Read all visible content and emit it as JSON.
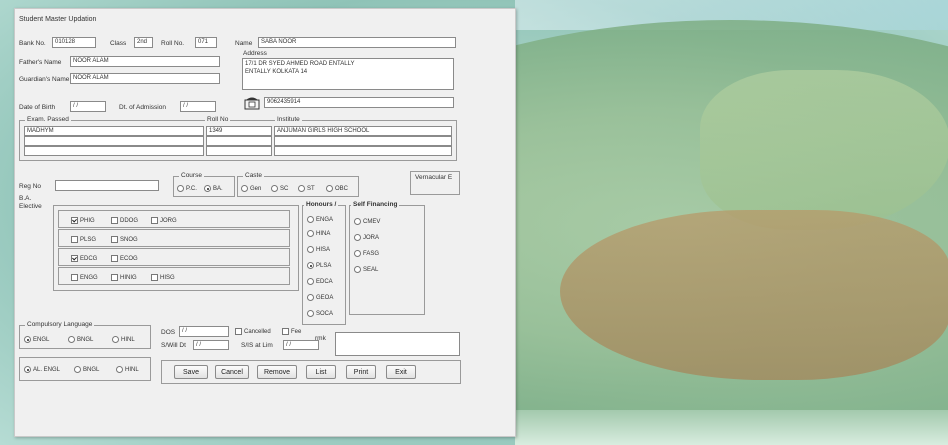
{
  "window": {
    "title": "Student Master Updation"
  },
  "fields": {
    "bank_no_label": "Bank No.",
    "bank_no_value": "010128",
    "class_label": "Class",
    "class_value": "2nd",
    "roll_no_label": "Roll No.",
    "roll_no_value": "071",
    "name_label": "Name",
    "name_value": "SABA NOOR",
    "father_label": "Father's Name",
    "father_value": "NOOR ALAM",
    "guardian_label": "Guardian's Name",
    "guardian_value": "NOOR ALAM",
    "address_label": "Address",
    "address_line1": "17/1 DR SYED AHMED ROAD ENTALLY",
    "address_line2": "ENTALLY KOLKATA 14",
    "dob_label": "Date of Birth",
    "dob_value": "/ /",
    "admission_label": "Dt. of Admission",
    "admission_value": "/ /",
    "phone_value": "9062435914",
    "reg_no_label": "Reg No",
    "ba_label": "B.A.",
    "elective_label": "Elective"
  },
  "exam_group": {
    "label": "Exam. Passed",
    "roll_label": "Roll No",
    "institute_label": "Institute",
    "exam_value": "MADHYM",
    "roll_value": "1349",
    "institute_value": "ANJUMAN GIRLS HIGH SCHOOL"
  },
  "course": {
    "label": "Course",
    "options": [
      "P.C.",
      "BA."
    ],
    "selected": 1
  },
  "caste": {
    "label": "Caste",
    "options": [
      "Gen",
      "SC",
      "ST",
      "OBC"
    ]
  },
  "vernacular_label": "Vernacular E",
  "elective_rows": [
    {
      "items": [
        {
          "label": "PHIG",
          "checked": true
        },
        {
          "label": "DDOG",
          "checked": false
        },
        {
          "label": "JORG",
          "checked": false
        }
      ]
    },
    {
      "items": [
        {
          "label": "PLSG",
          "checked": false
        },
        {
          "label": "SNOG",
          "checked": false
        }
      ]
    },
    {
      "items": [
        {
          "label": "EDCG",
          "checked": true
        },
        {
          "label": "ECOG",
          "checked": false
        }
      ]
    },
    {
      "items": [
        {
          "label": "ENGG",
          "checked": false
        },
        {
          "label": "HINIG",
          "checked": false
        },
        {
          "label": "HISG",
          "checked": false
        }
      ]
    }
  ],
  "honours": {
    "label": "Honours /",
    "options": [
      {
        "label": "ENGA",
        "on": false
      },
      {
        "label": "HINA",
        "on": false
      },
      {
        "label": "HISA",
        "on": false
      },
      {
        "label": "PLSA",
        "on": true
      },
      {
        "label": "EDCA",
        "on": false
      },
      {
        "label": "GEOA",
        "on": false
      },
      {
        "label": "SOCA",
        "on": false
      }
    ]
  },
  "self_financing": {
    "label": "Self Financing",
    "options": [
      "CMEV",
      "JORA",
      "FASG",
      "SEAL"
    ]
  },
  "compulsory": {
    "label": "Compulsory Language",
    "options": [
      "ENGL",
      "BNGL",
      "HINL"
    ],
    "selected": 0
  },
  "alt": {
    "options": [
      "AL. ENGL",
      "BNGL",
      "HINL"
    ],
    "selected": 0
  },
  "dates": {
    "dos_label": "DOS",
    "dos_value": "/ /",
    "cancelled_label": "Cancelled",
    "fee_label": "Fee",
    "remarks_label": "rmk",
    "slwill_label": "S/Will Dt",
    "slwill_value": "/ /",
    "slis_label": "S/IS at Lim",
    "slis_value": "/ /"
  },
  "buttons": {
    "save": "Save",
    "cancel": "Cancel",
    "remove": "Remove",
    "list": "List",
    "print": "Print",
    "exit": "Exit"
  }
}
